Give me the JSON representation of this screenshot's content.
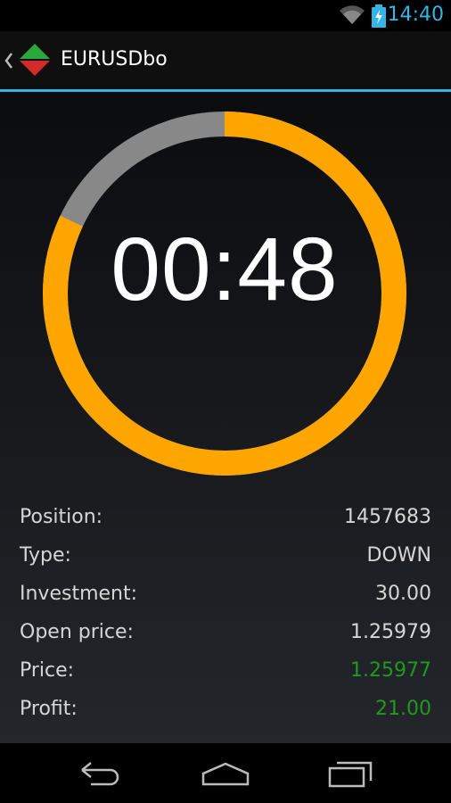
{
  "status_bar": {
    "time": "14:40",
    "icons": [
      "wifi-icon",
      "battery-charging-icon"
    ],
    "accent_color": "#33b5e5"
  },
  "action_bar": {
    "title": "EURUSDbo",
    "icons": [
      "up-chevron-icon",
      "up-down-arrows-icon"
    ]
  },
  "timer": {
    "display": "00:48",
    "progress_fraction_remaining": 0.82,
    "ring_color": "#ffa500",
    "elapsed_color": "#888888"
  },
  "details": [
    {
      "label": "Position:",
      "value": "1457683",
      "highlight": false
    },
    {
      "label": "Type:",
      "value": "DOWN",
      "highlight": false
    },
    {
      "label": "Investment:",
      "value": "30.00",
      "highlight": false
    },
    {
      "label": "Open price:",
      "value": "1.25979",
      "highlight": false
    },
    {
      "label": "Price:",
      "value": "1.25977",
      "highlight": true
    },
    {
      "label": "Profit:",
      "value": "21.00",
      "highlight": true
    }
  ],
  "colors": {
    "positive": "#1f9a1f",
    "text": "#d6d6d6"
  },
  "nav_bar": {
    "buttons": [
      "back-icon",
      "home-icon",
      "recents-icon"
    ]
  }
}
